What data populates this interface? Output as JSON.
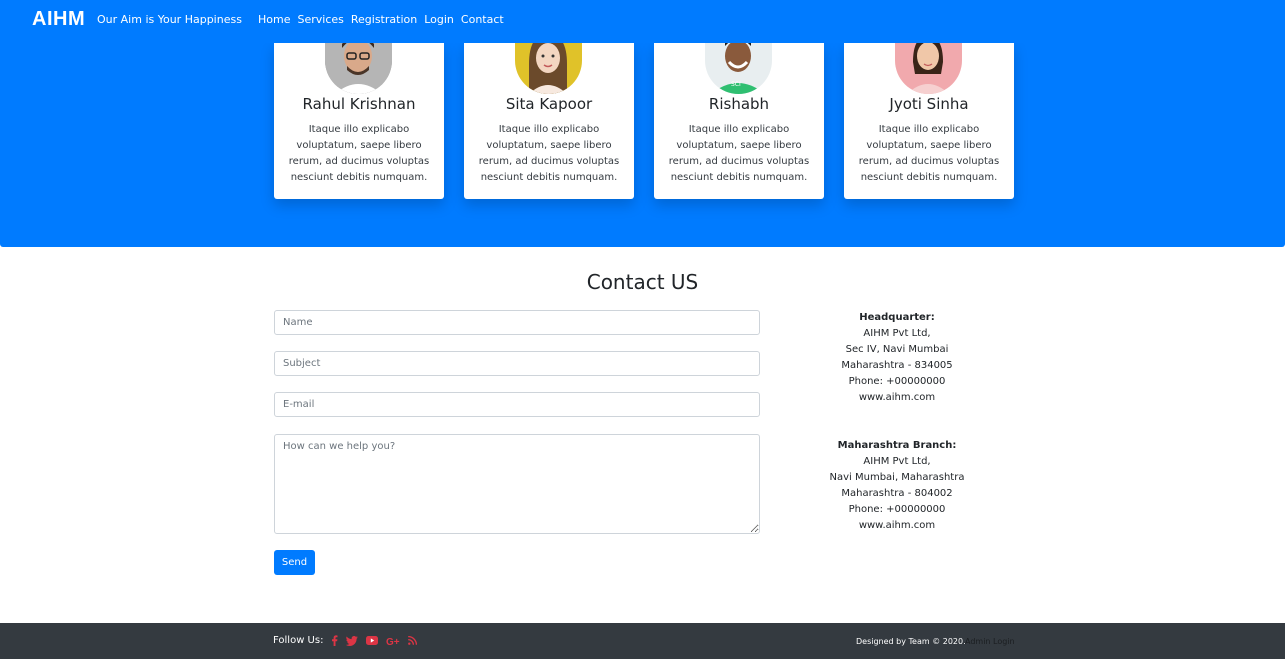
{
  "navbar": {
    "brand": "AIHM",
    "tagline": "Our Aim is Your Happiness",
    "links": [
      "Home",
      "Services",
      "Registration",
      "Login",
      "Contact"
    ]
  },
  "team": [
    {
      "name": "Rahul Krishnan",
      "text": "Itaque illo explicabo voluptatum, saepe libero rerum, ad ducimus voluptas nesciunt debitis numquam.",
      "avatar": "male-avatar-glasses"
    },
    {
      "name": "Sita Kapoor",
      "text": "Itaque illo explicabo voluptatum, saepe libero rerum, ad ducimus voluptas nesciunt debitis numquam.",
      "avatar": "female-avatar-yellow"
    },
    {
      "name": "Rishabh",
      "text": "Itaque illo explicabo voluptatum, saepe libero rerum, ad ducimus voluptas nesciunt debitis numquam.",
      "avatar": "male-avatar-green"
    },
    {
      "name": "Jyoti Sinha",
      "text": "Itaque illo explicabo voluptatum, saepe libero rerum, ad ducimus voluptas nesciunt debitis numquam.",
      "avatar": "female-avatar-pink"
    }
  ],
  "contact": {
    "title": "Contact US",
    "name_placeholder": "Name",
    "subject_placeholder": "Subject",
    "email_placeholder": "E-mail",
    "message_placeholder": "How can we help you?",
    "send_label": "Send"
  },
  "addresses": [
    {
      "heading": "Headquarter:",
      "lines": [
        "AIHM Pvt Ltd,",
        "Sec IV, Navi Mumbai",
        "Maharashtra - 834005",
        "Phone: +00000000",
        "www.aihm.com"
      ]
    },
    {
      "heading": "Maharashtra Branch:",
      "lines": [
        "AIHM Pvt Ltd,",
        "Navi Mumbai, Maharashtra",
        "Maharashtra - 804002",
        "Phone: +00000000",
        "www.aihm.com"
      ]
    }
  ],
  "footer": {
    "follow_label": "Follow Us:",
    "social_icons": [
      "facebook-icon",
      "twitter-icon",
      "youtube-icon",
      "google-plus-icon",
      "rss-icon"
    ],
    "designed_by": "Designed by Team © 2020.",
    "admin_login": "Admin Login"
  },
  "colors": {
    "primary": "#007bff",
    "footer": "#343a40",
    "social": "#dc3545"
  }
}
